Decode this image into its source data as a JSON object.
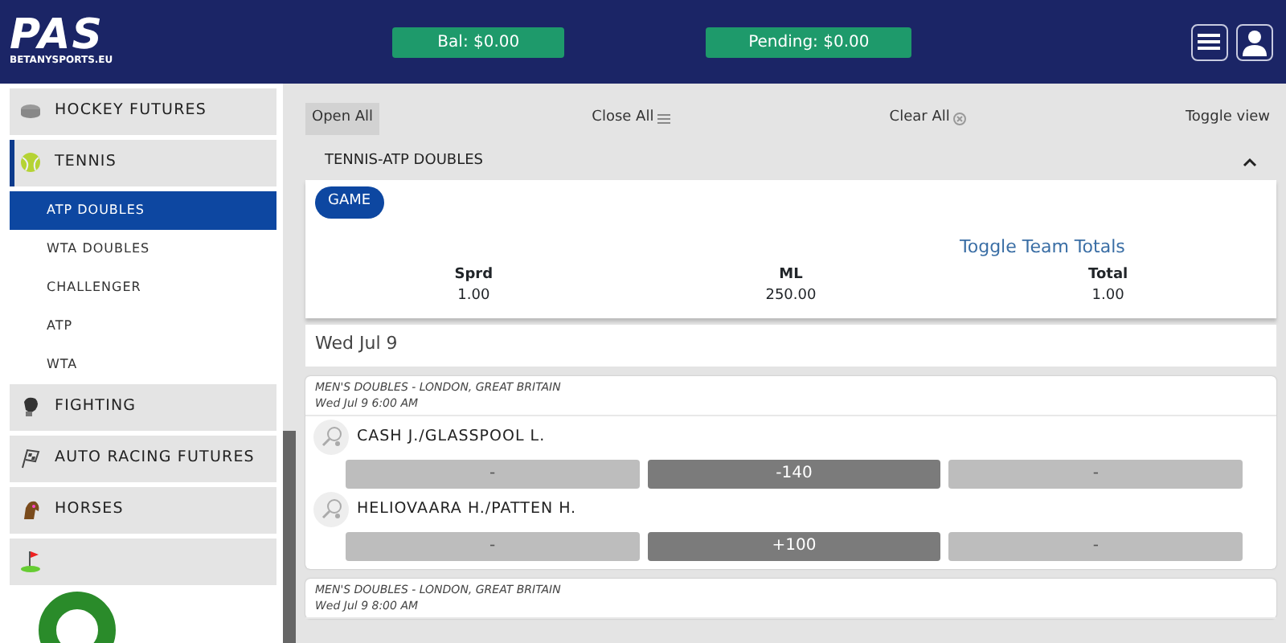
{
  "header": {
    "logo": "PAS",
    "logo_sub": "BETANYSPORTS.EU",
    "balance": "Bal:  $0.00",
    "pending": "Pending: $0.00"
  },
  "sidebar": {
    "items": [
      {
        "label": "HOCKEY FUTURES",
        "selected": false
      },
      {
        "label": "TENNIS",
        "selected": true,
        "children": [
          {
            "label": "ATP DOUBLES",
            "selected": true
          },
          {
            "label": "WTA DOUBLES",
            "selected": false
          },
          {
            "label": "CHALLENGER",
            "selected": false
          },
          {
            "label": "ATP",
            "selected": false
          },
          {
            "label": "WTA",
            "selected": false
          }
        ]
      },
      {
        "label": "FIGHTING",
        "selected": false
      },
      {
        "label": "AUTO RACING FUTURES",
        "selected": false
      },
      {
        "label": "HORSES",
        "selected": false
      },
      {
        "selected": false
      }
    ]
  },
  "toolbar": {
    "open_all": "Open All",
    "close_all": "Close All",
    "clear_all": "Clear All",
    "toggle_view": "Toggle view"
  },
  "league": {
    "title": "TENNIS-ATP DOUBLES",
    "expanded": true,
    "game_tab": "GAME",
    "toggle_totals": "Toggle Team Totals",
    "columns": [
      {
        "label": "Sprd",
        "value": "1.00"
      },
      {
        "label": "ML",
        "value": "250.00"
      },
      {
        "label": "Total",
        "value": "1.00"
      }
    ]
  },
  "date": "Wed Jul 9",
  "matches": [
    {
      "event": "MEN'S DOUBLES - LONDON, GREAT BRITAIN",
      "time": "Wed Jul 9 6:00 AM",
      "teams": [
        {
          "name": "CASH J./GLASSPOOL L.",
          "odds": [
            {
              "text": "-",
              "disabled": true
            },
            {
              "text": "-140",
              "disabled": false
            },
            {
              "text": "-",
              "disabled": true
            }
          ]
        },
        {
          "name": "HELIOVAARA H./PATTEN H.",
          "odds": [
            {
              "text": "-",
              "disabled": true
            },
            {
              "text": "+100",
              "disabled": false
            },
            {
              "text": "-",
              "disabled": true
            }
          ]
        }
      ]
    },
    {
      "event": "MEN'S DOUBLES - LONDON, GREAT BRITAIN",
      "time": "Wed Jul 9 8:00 AM"
    }
  ]
}
